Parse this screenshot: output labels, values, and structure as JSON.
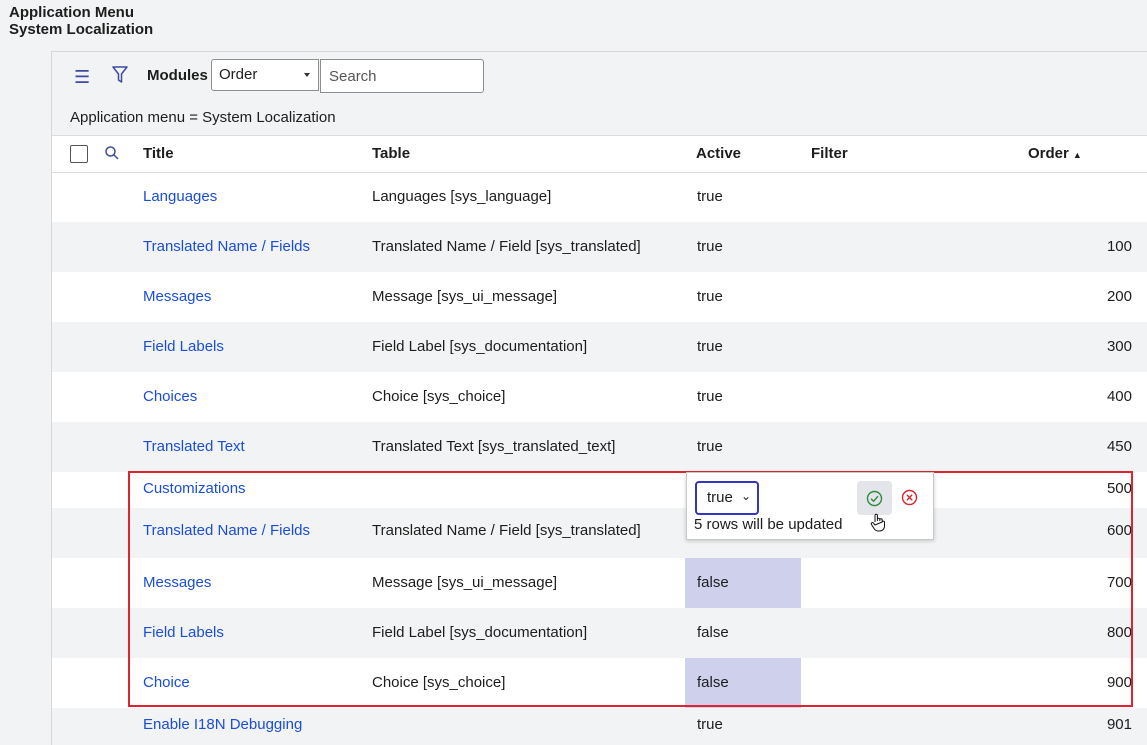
{
  "breadcrumb": {
    "line1": "Application Menu",
    "line2": "System Localization"
  },
  "toolbar": {
    "modules_label": "Modules",
    "order_select_value": "Order",
    "search_placeholder": "Search",
    "hamburger_icon": "hamburger-menu-icon",
    "filter_icon": "funnel-filter-icon"
  },
  "filter_breadcrumb": "Application menu = System Localization",
  "columns": {
    "title": "Title",
    "table": "Table",
    "active": "Active",
    "filter": "Filter",
    "order": "Order"
  },
  "rows": [
    {
      "title": "Languages",
      "table": "Languages [sys_language]",
      "active": "true",
      "order": ""
    },
    {
      "title": "Translated Name / Fields",
      "table": "Translated Name / Field [sys_translated]",
      "active": "true",
      "order": "100"
    },
    {
      "title": "Messages",
      "table": "Message [sys_ui_message]",
      "active": "true",
      "order": "200"
    },
    {
      "title": "Field Labels",
      "table": "Field Label [sys_documentation]",
      "active": "true",
      "order": "300"
    },
    {
      "title": "Choices",
      "table": "Choice [sys_choice]",
      "active": "true",
      "order": "400"
    },
    {
      "title": "Translated Text",
      "table": "Translated Text [sys_translated_text]",
      "active": "true",
      "order": "450"
    },
    {
      "title": "Customizations",
      "table": "",
      "active": "",
      "order": "500"
    },
    {
      "title": "Translated Name / Fields",
      "table": "Translated Name / Field [sys_translated]",
      "active": "",
      "order": "600"
    },
    {
      "title": "Messages",
      "table": "Message [sys_ui_message]",
      "active": "false",
      "order": "700"
    },
    {
      "title": "Field Labels",
      "table": "Field Label [sys_documentation]",
      "active": "false",
      "order": "800"
    },
    {
      "title": "Choice",
      "table": "Choice [sys_choice]",
      "active": "false",
      "order": "900"
    },
    {
      "title": "Enable I18N Debugging",
      "table": "",
      "active": "true",
      "order": "901"
    }
  ],
  "edit_popup": {
    "selected_value": "true",
    "message": "5 rows will be updated",
    "confirm_icon": "check-circle-icon",
    "cancel_icon": "x-circle-icon"
  },
  "colors": {
    "link": "#1a4ed8",
    "selection_border": "#e0242f",
    "highlight": "#cfd1ec",
    "accent": "#3535c4"
  }
}
